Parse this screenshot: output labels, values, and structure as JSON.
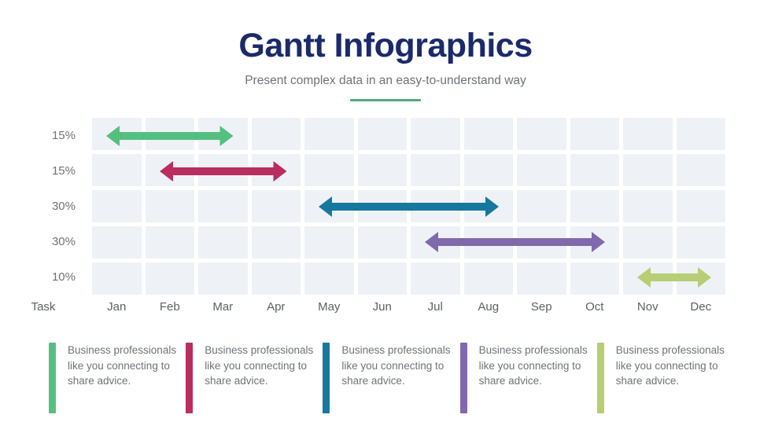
{
  "header": {
    "title": "Gantt Infographics",
    "subtitle": "Present complex data in an easy-to-understand way",
    "accent_color": "#4fa97b",
    "title_color": "#1b2a6b"
  },
  "axis": {
    "task_label": "Task",
    "months": [
      "Jan",
      "Feb",
      "Mar",
      "Apr",
      "May",
      "Jun",
      "Jul",
      "Aug",
      "Sep",
      "Oct",
      "Nov",
      "Dec"
    ]
  },
  "rows": [
    {
      "percent": "15%",
      "color": "#55bf82",
      "start_month": "Jan",
      "end_month": "Mar"
    },
    {
      "percent": "15%",
      "color": "#ba2d5f",
      "start_month": "Feb",
      "end_month": "Apr"
    },
    {
      "percent": "30%",
      "color": "#16789f",
      "start_month": "May",
      "end_month": "Aug"
    },
    {
      "percent": "30%",
      "color": "#8169ad",
      "start_month": "Jul",
      "end_month": "Oct"
    },
    {
      "percent": "10%",
      "color": "#b7cd76",
      "start_month": "Nov",
      "end_month": "Dec"
    }
  ],
  "legend": [
    {
      "color": "#55bf82",
      "text": "Business professionals like you connecting to share advice."
    },
    {
      "color": "#ba2d5f",
      "text": "Business professionals like you connecting to share advice."
    },
    {
      "color": "#16789f",
      "text": "Business professionals like you connecting to share advice."
    },
    {
      "color": "#8169ad",
      "text": "Business professionals like you connecting to share advice."
    },
    {
      "color": "#b7cd76",
      "text": "Business professionals like you connecting to share advice."
    }
  ],
  "grid": {
    "columns": 12,
    "rows": 5,
    "cell_color": "#eef2f6"
  },
  "chart_data": {
    "type": "bar",
    "title": "Gantt Infographics",
    "subtitle": "Present complex data in an easy-to-understand way",
    "xlabel": "",
    "ylabel": "",
    "categories": [
      "Jan",
      "Feb",
      "Mar",
      "Apr",
      "May",
      "Jun",
      "Jul",
      "Aug",
      "Sep",
      "Oct",
      "Nov",
      "Dec"
    ],
    "row_labels": [
      "15%",
      "15%",
      "30%",
      "30%",
      "10%"
    ],
    "tasks": [
      {
        "label": "15%",
        "start_index": 0,
        "end_index": 2,
        "start_month": "Jan",
        "end_month": "Mar",
        "duration_months": 3,
        "value": 15,
        "color": "#55bf82"
      },
      {
        "label": "15%",
        "start_index": 1,
        "end_index": 3,
        "start_month": "Feb",
        "end_month": "Apr",
        "duration_months": 3,
        "value": 15,
        "color": "#ba2d5f"
      },
      {
        "label": "30%",
        "start_index": 4,
        "end_index": 7,
        "start_month": "May",
        "end_month": "Aug",
        "duration_months": 4,
        "value": 30,
        "color": "#16789f"
      },
      {
        "label": "30%",
        "start_index": 6,
        "end_index": 9,
        "start_month": "Jul",
        "end_month": "Oct",
        "duration_months": 4,
        "value": 30,
        "color": "#8169ad"
      },
      {
        "label": "10%",
        "start_index": 10,
        "end_index": 11,
        "start_month": "Nov",
        "end_month": "Dec",
        "duration_months": 2,
        "value": 10,
        "color": "#b7cd76"
      }
    ],
    "grid": true,
    "legend_position": "bottom",
    "notes": "Horizontal double-headed arrows spanning month ranges on a 12-column grid"
  }
}
